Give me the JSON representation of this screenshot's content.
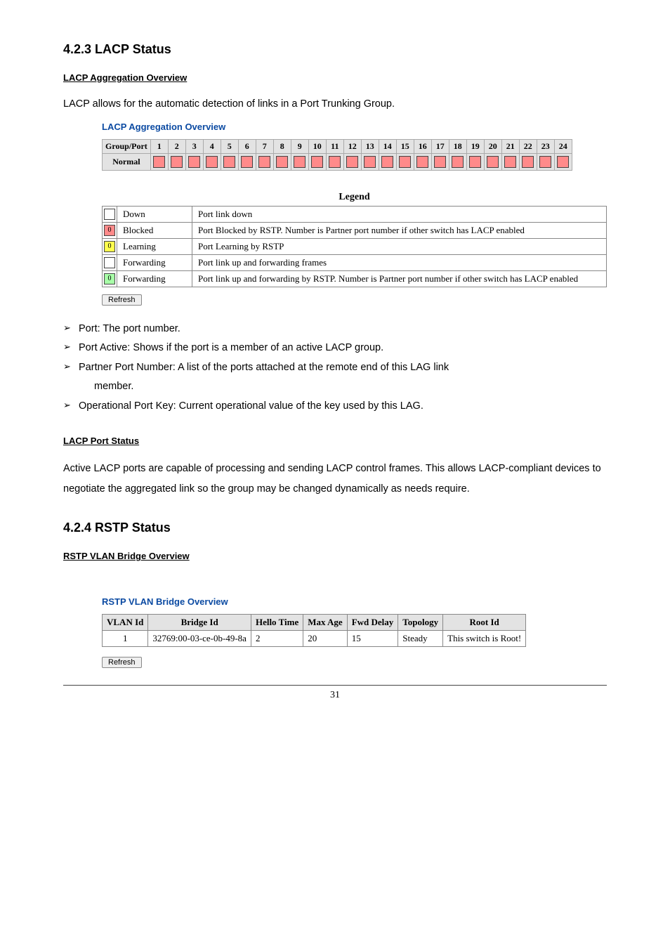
{
  "h_423": "4.2.3 LACP Status",
  "h_lacp_agg": "LACP Aggregation Overview",
  "p_lacp_intro": "LACP allows for the automatic detection of links in a Port Trunking Group.",
  "fig_agg_title": "LACP Aggregation Overview",
  "agg": {
    "hdr": "Group/Port",
    "row0": "Normal",
    "ports": [
      "1",
      "2",
      "3",
      "4",
      "5",
      "6",
      "7",
      "8",
      "9",
      "10",
      "11",
      "12",
      "13",
      "14",
      "15",
      "16",
      "17",
      "18",
      "19",
      "20",
      "21",
      "22",
      "23",
      "24"
    ]
  },
  "legend": {
    "title": "Legend",
    "rows": [
      {
        "color": "",
        "state": "Down",
        "desc": "Port link down"
      },
      {
        "color": "#ff8a8a",
        "badge": "0",
        "state": "Blocked",
        "desc": "Port Blocked by RSTP. Number is Partner port number if other switch has LACP enabled"
      },
      {
        "color": "#ffff4d",
        "badge": "0",
        "state": "Learning",
        "desc": "Port Learning by RSTP"
      },
      {
        "color": "",
        "state": "Forwarding",
        "desc": "Port link up and forwarding frames"
      },
      {
        "color": "#a8ffa8",
        "badge": "0",
        "state": "Forwarding",
        "desc": "Port link up and forwarding by RSTP. Number is Partner port number if other switch has LACP enabled"
      }
    ],
    "refresh": "Refresh"
  },
  "bullets": {
    "b1": "Port: The port number.",
    "b2": "Port Active: Shows if the port is a member of an active LACP group.",
    "b3": "Partner Port Number: A list of the ports attached at the remote end of this LAG link",
    "b3s": "member.",
    "b4": "Operational Port Key: Current operational value of the key used by this LAG."
  },
  "h_lacp_port": "LACP Port Status",
  "p_lacp_port": "Active LACP ports are capable of processing and sending LACP control frames. This allows LACP-compliant devices to negotiate the aggregated link so the group may be changed dynamically as needs require.",
  "h_424": "4.2.4 RSTP Status",
  "h_rstp_vlan": "RSTP VLAN Bridge Overview",
  "fig_rstp_title": "RSTP VLAN Bridge Overview",
  "rstp": {
    "headers": [
      "VLAN Id",
      "Bridge Id",
      "Hello Time",
      "Max Age",
      "Fwd Delay",
      "Topology",
      "Root Id"
    ],
    "row": [
      "1",
      "32769:00-03-ce-0b-49-8a",
      "2",
      "20",
      "15",
      "Steady",
      "This switch is Root!"
    ],
    "refresh": "Refresh"
  },
  "page_no": "31"
}
